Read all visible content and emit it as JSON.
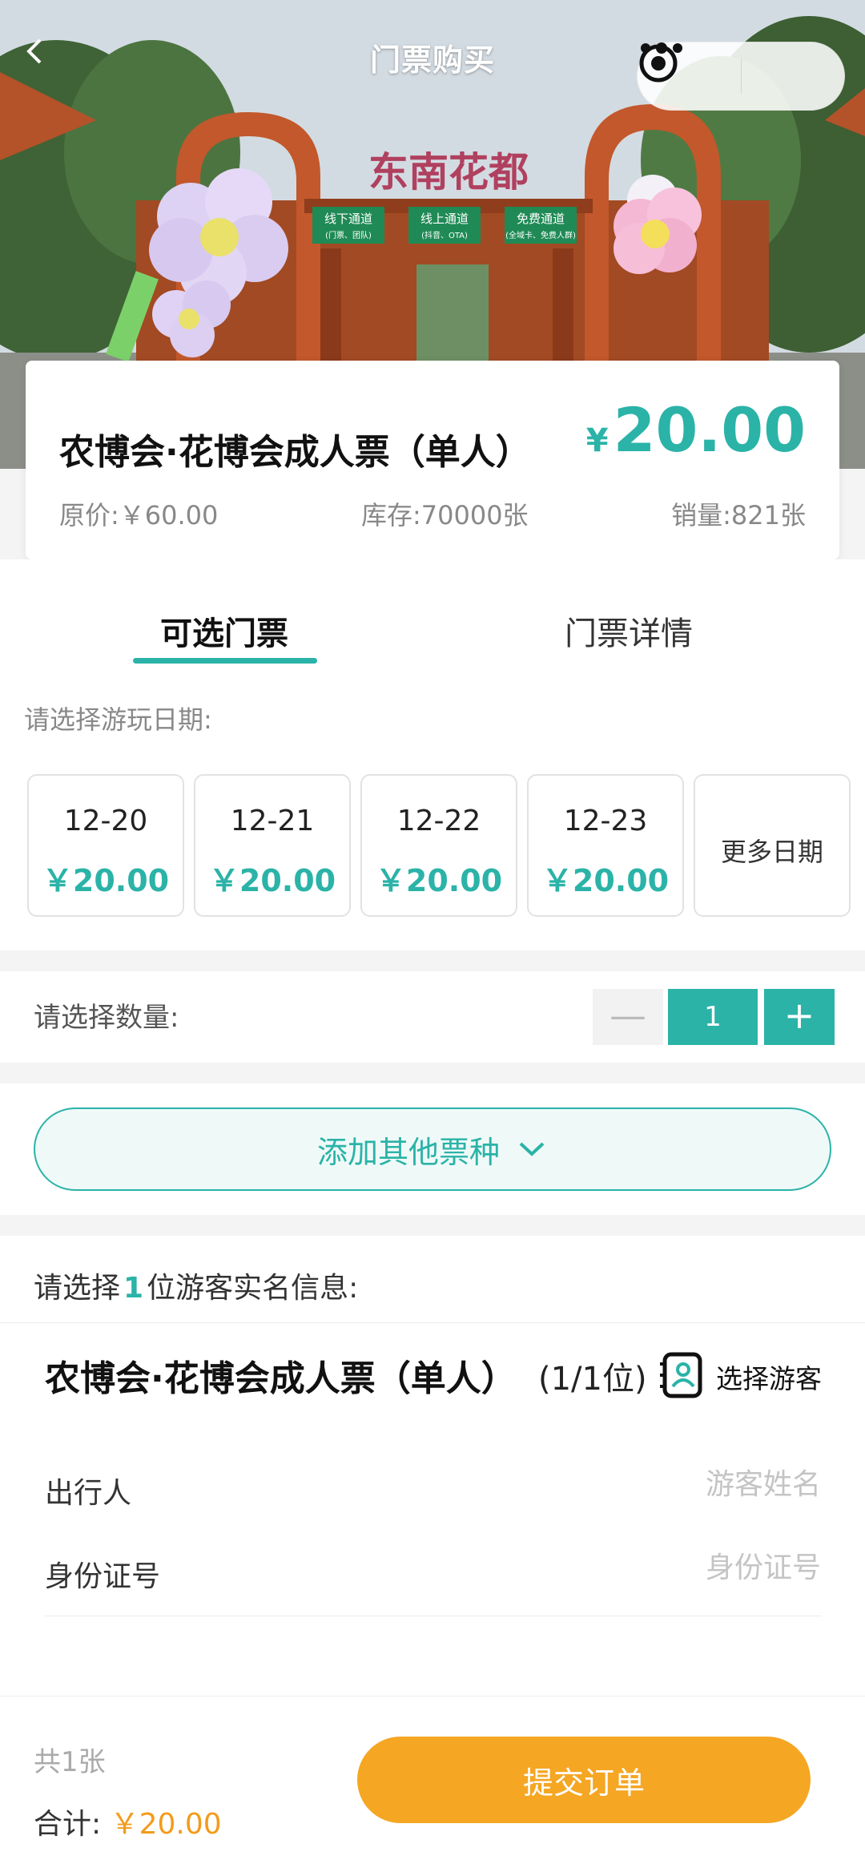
{
  "header": {
    "title": "门票购买",
    "back_icon": "chevron-left-icon",
    "more_icon": "more-dots-icon",
    "close_icon": "target-icon"
  },
  "hero": {
    "gate_title": "东南花都",
    "signs": [
      "线下通道",
      "线上通道",
      "免费通道"
    ],
    "sign_subtitles": [
      "(门票、团队)",
      "(抖音、OTA)",
      "(全域卡、免费人群)"
    ]
  },
  "ticket": {
    "name": "农博会·花博会成人票（单人）",
    "currency": "¥",
    "price": "20.00",
    "original_price": "原价:￥60.00",
    "stock": "库存:70000张",
    "sales": "销量:821张"
  },
  "tabs": {
    "selectable": "可选门票",
    "details": "门票详情",
    "active": "selectable"
  },
  "date_picker": {
    "prompt": "请选择游玩日期:",
    "dates": [
      {
        "date": "12-20",
        "price": "￥20.00"
      },
      {
        "date": "12-21",
        "price": "￥20.00"
      },
      {
        "date": "12-22",
        "price": "￥20.00"
      },
      {
        "date": "12-23",
        "price": "￥20.00"
      }
    ],
    "more": "更多日期"
  },
  "quantity": {
    "label": "请选择数量:",
    "minus": "—",
    "value": "1",
    "plus": "+"
  },
  "add_ticket": {
    "label": "添加其他票种",
    "icon": "chevron-down-icon"
  },
  "visitor": {
    "prompt_prefix": "请选择",
    "prompt_count": "1",
    "prompt_suffix": "位游客实名信息:",
    "ticket_name": "农博会·花博会成人票（单人）",
    "ticket_count": "(1/1位)",
    "choose_label": "选择游客",
    "contact_icon": "contact-book-icon",
    "fields": [
      {
        "label": "出行人",
        "placeholder": "游客姓名",
        "value": ""
      },
      {
        "label": "身份证号",
        "placeholder": "身份证号",
        "value": ""
      }
    ]
  },
  "footer": {
    "count": "共1张",
    "total_label": "合计:",
    "total_amount": "￥20.00",
    "submit": "提交订单"
  },
  "colors": {
    "accent": "#2bb3a8",
    "submit": "#f5a623",
    "total": "#f39b1c"
  }
}
